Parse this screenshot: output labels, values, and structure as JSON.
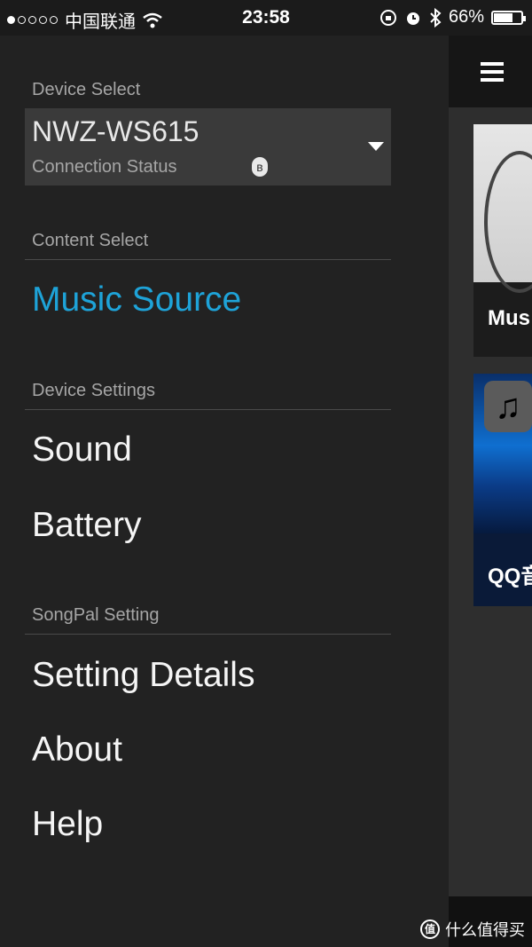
{
  "status_bar": {
    "carrier": "中国联通",
    "time": "23:58",
    "battery": "66%",
    "battery_level": 0.66
  },
  "drawer": {
    "device_select_label": "Device Select",
    "device_name": "NWZ-WS615",
    "connection_status": "Connection Status",
    "content_select_label": "Content Select",
    "music_source": "Music Source",
    "device_settings_label": "Device Settings",
    "sound": "Sound",
    "battery": "Battery",
    "songpal_setting_label": "SongPal Setting",
    "setting_details": "Setting Details",
    "about": "About",
    "help": "Help"
  },
  "peek": {
    "card1_label": "Mus",
    "card2_label": "QQ音"
  },
  "watermark": {
    "logo_text": "值",
    "text": "什么值得买"
  },
  "colors": {
    "accent": "#1ea3d8",
    "background": "#222222"
  }
}
